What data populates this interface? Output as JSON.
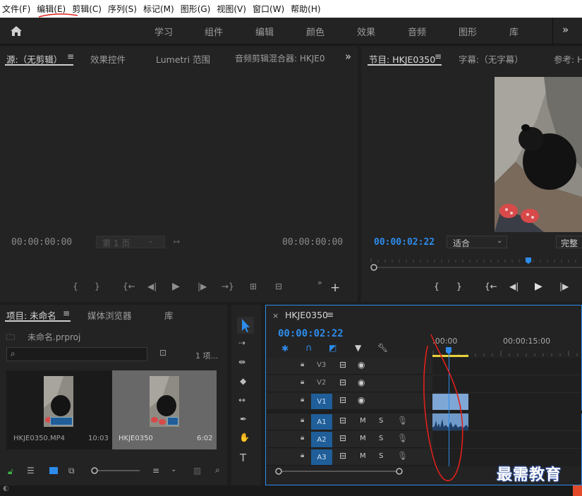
{
  "menu": [
    "文件(F)",
    "编辑(E)",
    "剪辑(C)",
    "序列(S)",
    "标记(M)",
    "图形(G)",
    "视图(V)",
    "窗口(W)",
    "帮助(H)"
  ],
  "workspaces": [
    "学习",
    "组件",
    "编辑",
    "颜色",
    "效果",
    "音频",
    "图形",
    "库"
  ],
  "source_panel": {
    "tabs": [
      "源:（无剪辑）",
      "效果控件",
      "Lumetri 范围",
      "音频剪辑混合器: HKJE0"
    ],
    "tc_left": "00:00:00:00",
    "page": "第 1 页",
    "tc_right": "00:00:00:00"
  },
  "program_panel": {
    "tabs": [
      "节目: HKJE0350",
      "字幕:（无字幕）",
      "参考: H"
    ],
    "timecode": "00:00:02:22",
    "fit": "适合",
    "quality": "完整"
  },
  "project_panel": {
    "tabs": [
      "项目: 未命名",
      "媒体浏览器",
      "库"
    ],
    "project_file": "未命名.prproj",
    "search_placeholder": "",
    "item_count": "1 项...",
    "items": [
      {
        "name": "HKJE0350.MP4",
        "duration": "10:03"
      },
      {
        "name": "HKJE0350",
        "duration": "6:02"
      }
    ]
  },
  "timeline": {
    "sequence": "HKJE0350",
    "timecode": "00:00:02:22",
    "ruler": [
      ":00:00",
      "00:00:15:00"
    ],
    "video_tracks": [
      "V3",
      "V2",
      "V1"
    ],
    "audio_tracks": [
      "A1",
      "A2",
      "A3"
    ],
    "mute": "M",
    "solo": "S"
  },
  "watermark": "最需教育",
  "colors": {
    "accent": "#2d8ceb",
    "clip_video": "#7fa7d6",
    "clip_audio": "#6f9ac9",
    "annotation": "#e0201b"
  }
}
